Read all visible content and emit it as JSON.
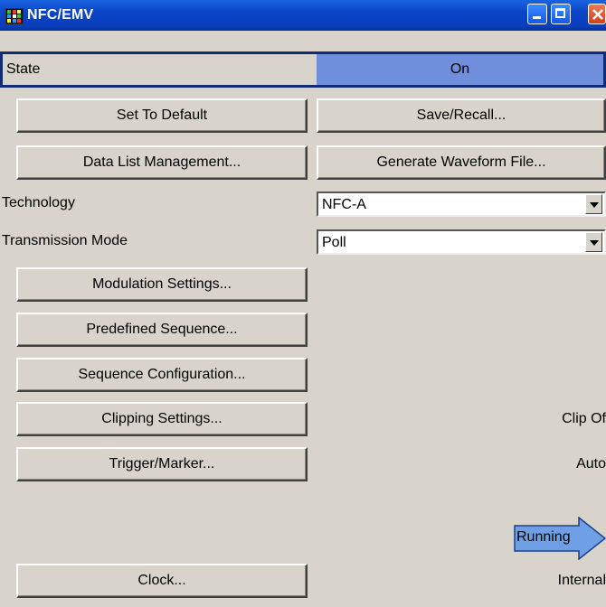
{
  "window": {
    "title": "NFC/EMV"
  },
  "state": {
    "label": "State",
    "value": "On"
  },
  "buttons": {
    "set_default": "Set To Default",
    "save_recall": "Save/Recall...",
    "data_list": "Data List Management...",
    "generate_waveform": "Generate Waveform File...",
    "modulation": "Modulation Settings...",
    "predefined": "Predefined Sequence...",
    "sequence_config": "Sequence Configuration...",
    "clipping": "Clipping Settings...",
    "trigger_marker": "Trigger/Marker...",
    "clock": "Clock..."
  },
  "technology": {
    "label": "Technology",
    "value": "NFC-A"
  },
  "transmission_mode": {
    "label": "Transmission Mode",
    "value": "Poll"
  },
  "status": {
    "clipping": "Clip Of",
    "trigger": "Auto",
    "running": "Running",
    "clock": "Internal"
  },
  "colors": {
    "titlebar": "#0a44c8",
    "state_on": "#6f8fdd",
    "running_arrow": "#6fa0e6",
    "background": "#d8d4cc"
  }
}
